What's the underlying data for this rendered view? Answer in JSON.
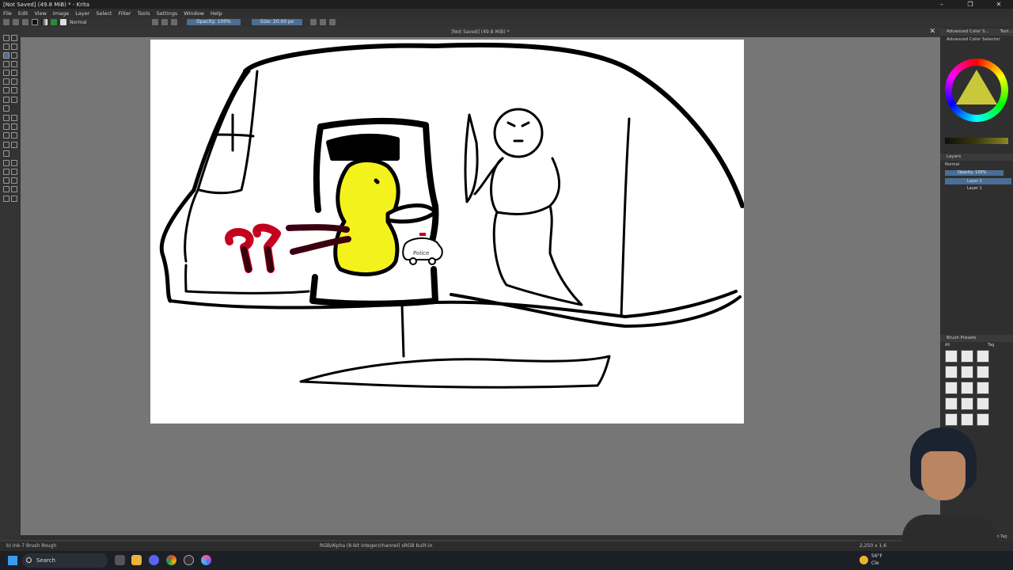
{
  "window": {
    "title": "[Not Saved]  (49.8 MiB) * - Krita",
    "buttons": [
      "–",
      "❐",
      "✕"
    ]
  },
  "menu": [
    "File",
    "Edit",
    "View",
    "Image",
    "Layer",
    "Select",
    "Filter",
    "Tools",
    "Settings",
    "Window",
    "Help"
  ],
  "toolbar": {
    "blend_mode": "Normal",
    "opacity": "Opacity: 100%",
    "size": "Size: 20.00 px"
  },
  "document_tab": {
    "title": "[Not Saved]  (49.8 MiB) *"
  },
  "dockers": {
    "color_selector_tabs": [
      "Advanced Color S...",
      "Tool..."
    ],
    "color_selector_title": "Advanced Color Selector",
    "layers_title": "Layers",
    "layers_blend": "Normal",
    "layers_opacity": "Opacity: 100%",
    "layers": [
      {
        "name": "Layer 2",
        "selected": true
      },
      {
        "name": "Layer 1",
        "selected": false
      }
    ],
    "brush_presets_title": "Brush Presets",
    "brush_filter": "All",
    "brush_tag": "Tag",
    "filter_in_tag": "Filter in Tag"
  },
  "statusbar": {
    "brush": "b) Ink-7 Brush Rough",
    "color_space": "RGB/Alpha (8-bit integer/channel)  sRGB built-in",
    "dimensions": "2,250 x 1,6"
  },
  "taskbar": {
    "search_placeholder": "Search",
    "weather_temp": "56°F",
    "weather_text": "Cle"
  },
  "colors": {
    "accent": "#4a6e95",
    "duck_yellow": "#f4f21c",
    "paint_red": "#c4001f",
    "ink_black": "#000000"
  },
  "drawing": {
    "police_label": "Police"
  }
}
